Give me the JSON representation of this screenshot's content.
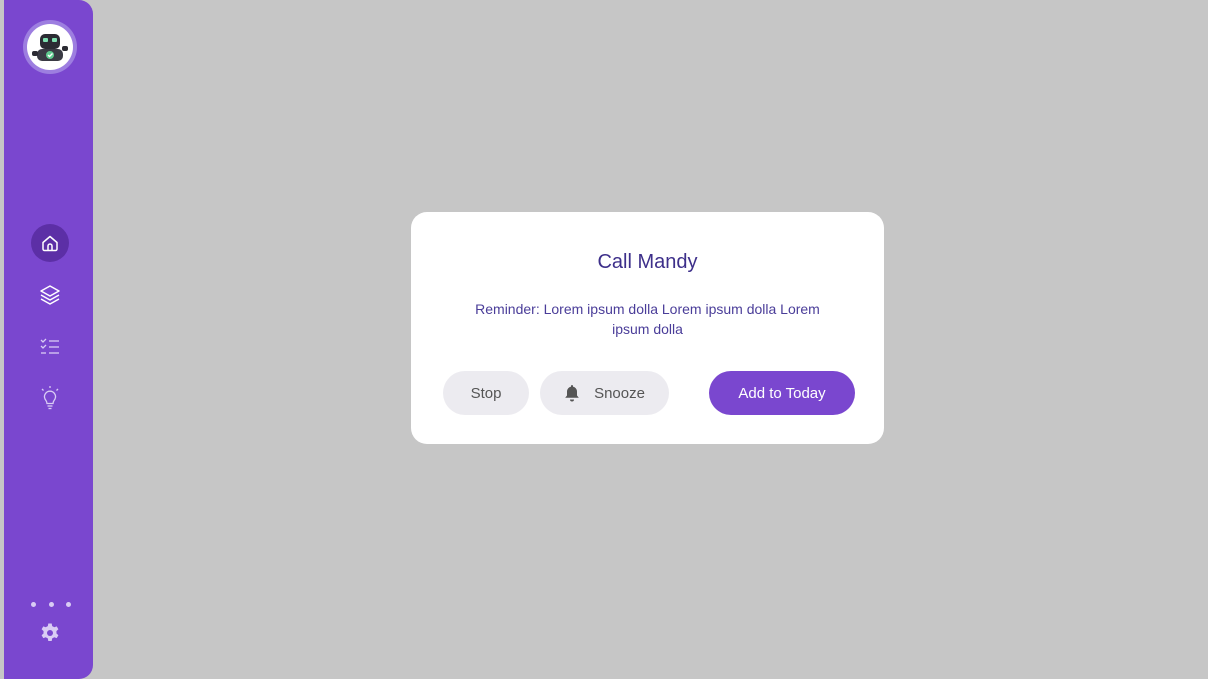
{
  "colors": {
    "sidebar": "#7a47cf",
    "sidebar_active": "#5c2fa6",
    "backdrop": "#c6c6c6",
    "dialog_bg": "#ffffff",
    "primary_button": "#7a47cf",
    "secondary_button": "#ecebf0",
    "title_text": "#3d2f8a"
  },
  "sidebar": {
    "avatar_icon": "robot-avatar-icon",
    "items": [
      {
        "icon": "home-icon",
        "active": true
      },
      {
        "icon": "layers-icon",
        "active": false
      },
      {
        "icon": "checklist-icon",
        "active": false
      },
      {
        "icon": "lightbulb-icon",
        "active": false
      }
    ],
    "more_icon": "more-dots-icon",
    "settings_icon": "gear-icon"
  },
  "dialog": {
    "title": "Call Mandy",
    "message": "Reminder: Lorem ipsum dolla Lorem ipsum dolla Lorem ipsum dolla",
    "buttons": {
      "stop": "Stop",
      "snooze": "Snooze",
      "add": "Add to Today"
    }
  }
}
